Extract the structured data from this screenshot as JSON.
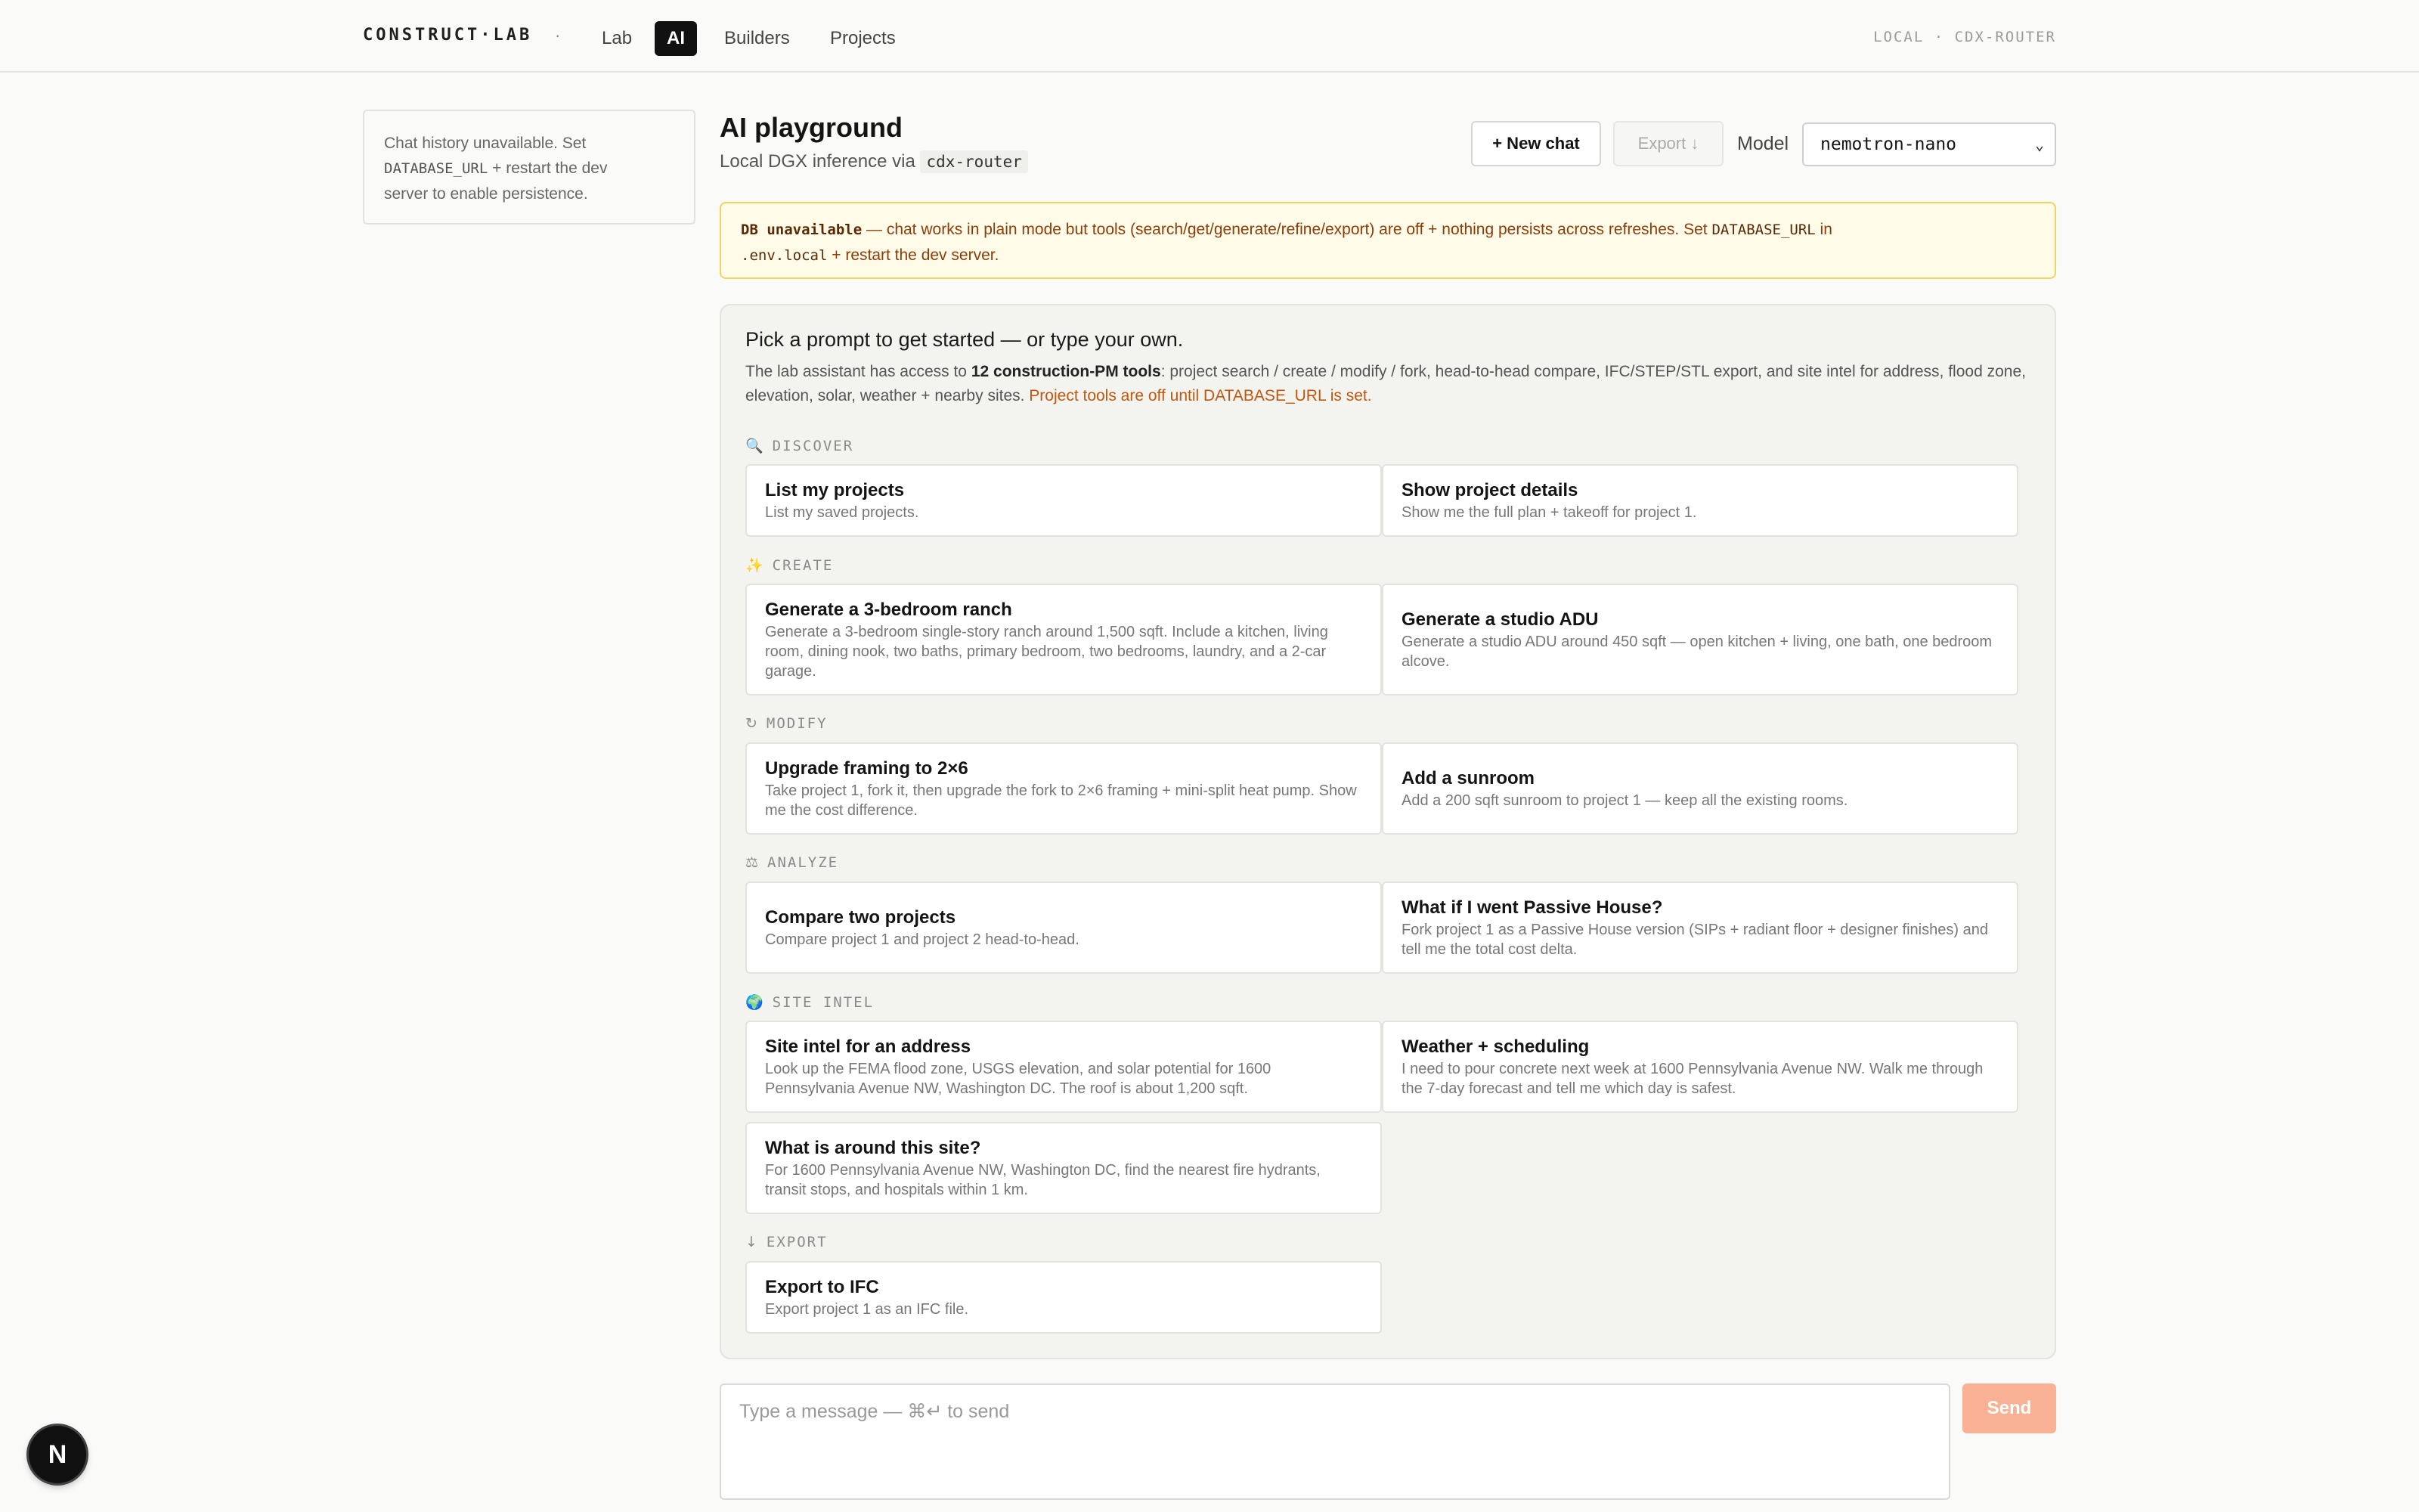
{
  "nav": {
    "brand": "CONSTRUCT·LAB",
    "separator": "·",
    "tabs": [
      {
        "label": "Lab",
        "active": false
      },
      {
        "label": "AI",
        "active": true
      },
      {
        "label": "Builders",
        "active": false
      },
      {
        "label": "Projects",
        "active": false
      }
    ],
    "env": "LOCAL · CDX-ROUTER"
  },
  "sidebar": {
    "text1": "Chat history unavailable. Set",
    "code": "DATABASE_URL",
    "text2": " + restart the dev",
    "text3": "server to enable persistence."
  },
  "header": {
    "title": "AI playground",
    "subtitle": "Local DGX inference via",
    "router": "cdx-router",
    "new_chat": "+ New chat",
    "export": "Export ↓",
    "model_label": "Model",
    "model_value": "nemotron-nano"
  },
  "banner": {
    "strong": "DB unavailable",
    "text1": " — chat works in plain mode but tools (search/get/generate/refine/export) are off + nothing persists across refreshes. Set ",
    "code1": "DATABASE_URL",
    "text2": " in",
    "code2": ".env.local",
    "text3": " + restart the dev server."
  },
  "panel": {
    "heading": "Pick a prompt to get started — or type your own.",
    "desc1": "The lab assistant has access to ",
    "desc_bold": "12 construction-PM tools",
    "desc2": ": project search / create / modify / fork, head-to-head compare, IFC/STEP/STL export, and site intel for address, flood zone, elevation, solar, weather + nearby sites. ",
    "desc_warn": "Project tools are off until DATABASE_URL is set."
  },
  "sections": [
    {
      "icon": "🔍",
      "label": "DISCOVER"
    },
    {
      "icon": "✨",
      "label": "CREATE"
    },
    {
      "icon": "↻",
      "label": "MODIFY"
    },
    {
      "icon": "⚖",
      "label": "ANALYZE"
    },
    {
      "icon": "🌍",
      "label": "SITE INTEL"
    },
    {
      "icon": "↓",
      "label": "EXPORT"
    }
  ],
  "prompts": [
    {
      "title": "List my projects",
      "desc": "List my saved projects."
    },
    {
      "title": "Show project details",
      "desc": "Show me the full plan + takeoff for project 1."
    },
    {
      "title": "Generate a 3-bedroom ranch",
      "desc": "Generate a 3-bedroom single-story ranch around 1,500 sqft. Include a kitchen, living room, dining nook, two baths, primary bedroom, two bedrooms, laundry, and a 2-car garage."
    },
    {
      "title": "Generate a studio ADU",
      "desc": "Generate a studio ADU around 450 sqft — open kitchen + living, one bath, one bedroom alcove."
    },
    {
      "title": "Upgrade framing to 2×6",
      "desc": "Take project 1, fork it, then upgrade the fork to 2×6 framing + mini-split heat pump. Show me the cost difference."
    },
    {
      "title": "Add a sunroom",
      "desc": "Add a 200 sqft sunroom to project 1 — keep all the existing rooms."
    },
    {
      "title": "Compare two projects",
      "desc": "Compare project 1 and project 2 head-to-head."
    },
    {
      "title": "What if I went Passive House?",
      "desc": "Fork project 1 as a Passive House version (SIPs + radiant floor + designer finishes) and tell me the total cost delta."
    },
    {
      "title": "Site intel for an address",
      "desc": "Look up the FEMA flood zone, USGS elevation, and solar potential for 1600 Pennsylvania Avenue NW, Washington DC. The roof is about 1,200 sqft."
    },
    {
      "title": "Weather + scheduling",
      "desc": "I need to pour concrete next week at 1600 Pennsylvania Avenue NW. Walk me through the 7-day forecast and tell me which day is safest."
    },
    {
      "title": "What is around this site?",
      "desc": "For 1600 Pennsylvania Avenue NW, Washington DC, find the nearest fire hydrants, transit stops, and hospitals within 1 km."
    },
    {
      "title": "Export to IFC",
      "desc": "Export project 1 as an IFC file."
    }
  ],
  "composer": {
    "placeholder": "Type a message — ⌘↵ to send",
    "send": "Send"
  },
  "dev_badge": "N"
}
